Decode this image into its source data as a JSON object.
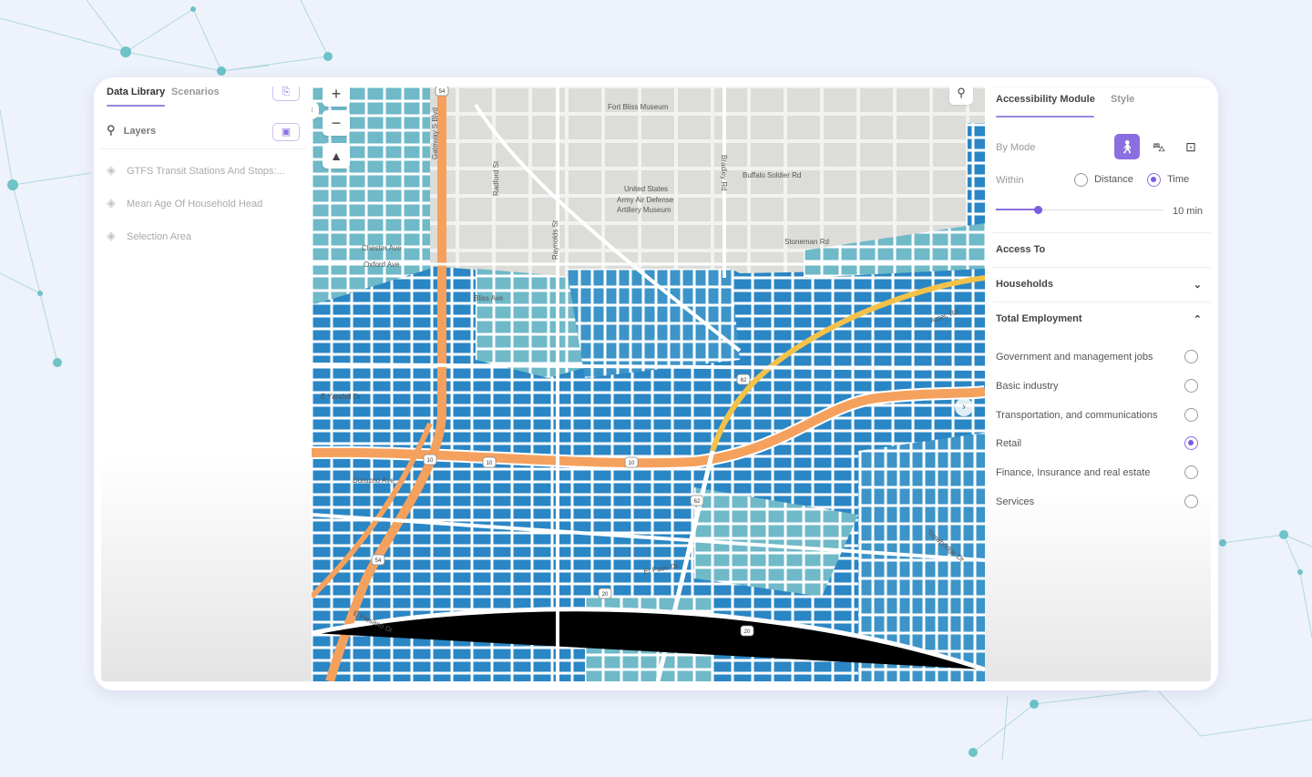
{
  "left_panel": {
    "tabs": [
      "Data Library",
      "Scenarios"
    ],
    "active_tab": "Data Library",
    "search_label": "Layers",
    "layers": [
      {
        "icon": "layers-icon",
        "label": "GTFS Transit Stations And Stops:..."
      },
      {
        "icon": "layers-icon",
        "label": "Mean Age Of Household Head"
      },
      {
        "icon": "layers-icon",
        "label": "Selection Area"
      }
    ]
  },
  "map": {
    "controls": {
      "zoom_in": "+",
      "zoom_out": "−",
      "north": "▲"
    },
    "labels": {
      "fort_bliss_museum": "Fort Bliss Museum",
      "buffalo_soldier": "Buffalo Soldier Rd",
      "bradley": "Bradley Rd",
      "museum1": "United States",
      "museum2": "Army Air Defense",
      "museum3": "Artillery Museum",
      "stoneman": "Stoneman Rd",
      "raynolds": "Raynolds St",
      "radford": "Radford St",
      "gateway": "Gateway S Blvd",
      "trowbridge": "Trowbridge Dr",
      "el_paso_dr": "El Paso Dr",
      "aztec": "Aztec Rd",
      "paisano": "E Paisano Dr",
      "chester": "Chester Ave",
      "oxford": "Oxford Ave",
      "bliss": "Bliss Ave",
      "yandell": "E Yandell Dr",
      "durazno": "Durazno Ave"
    },
    "shields": [
      "54",
      "10",
      "10",
      "10",
      "62",
      "62",
      "20",
      "20",
      "54"
    ],
    "colors": {
      "high": "#2a86c4",
      "mid": "#5fb2c9",
      "low": "#a8d8c4",
      "base": "#dcdcd8",
      "highway": "#f5a15e",
      "arterial": "#f3c24a"
    }
  },
  "right_panel": {
    "tabs": [
      "Accessibility Module",
      "Style"
    ],
    "active_tab": "Accessibility Module",
    "by_mode_label": "By Mode",
    "modes": [
      {
        "icon": "walk-icon",
        "selected": true
      },
      {
        "icon": "car-icon",
        "selected": false
      },
      {
        "icon": "transit-icon",
        "selected": false
      }
    ],
    "within_label": "Within",
    "within_options": [
      "Distance",
      "Time"
    ],
    "within_selected": "Time",
    "slider_value": "10 min",
    "slider_fraction": 0.25,
    "access_to_label": "Access To",
    "households_label": "Households",
    "total_employment_label": "Total Employment",
    "employment_options": [
      {
        "label": "Government and management jobs",
        "selected": false
      },
      {
        "label": "Basic industry",
        "selected": false
      },
      {
        "label": "Transportation, and communications",
        "selected": false
      },
      {
        "label": "Retail",
        "selected": true
      },
      {
        "label": "Finance, Insurance and real estate",
        "selected": false
      },
      {
        "label": "Services",
        "selected": false
      }
    ],
    "accent": "#8b6fe0"
  }
}
